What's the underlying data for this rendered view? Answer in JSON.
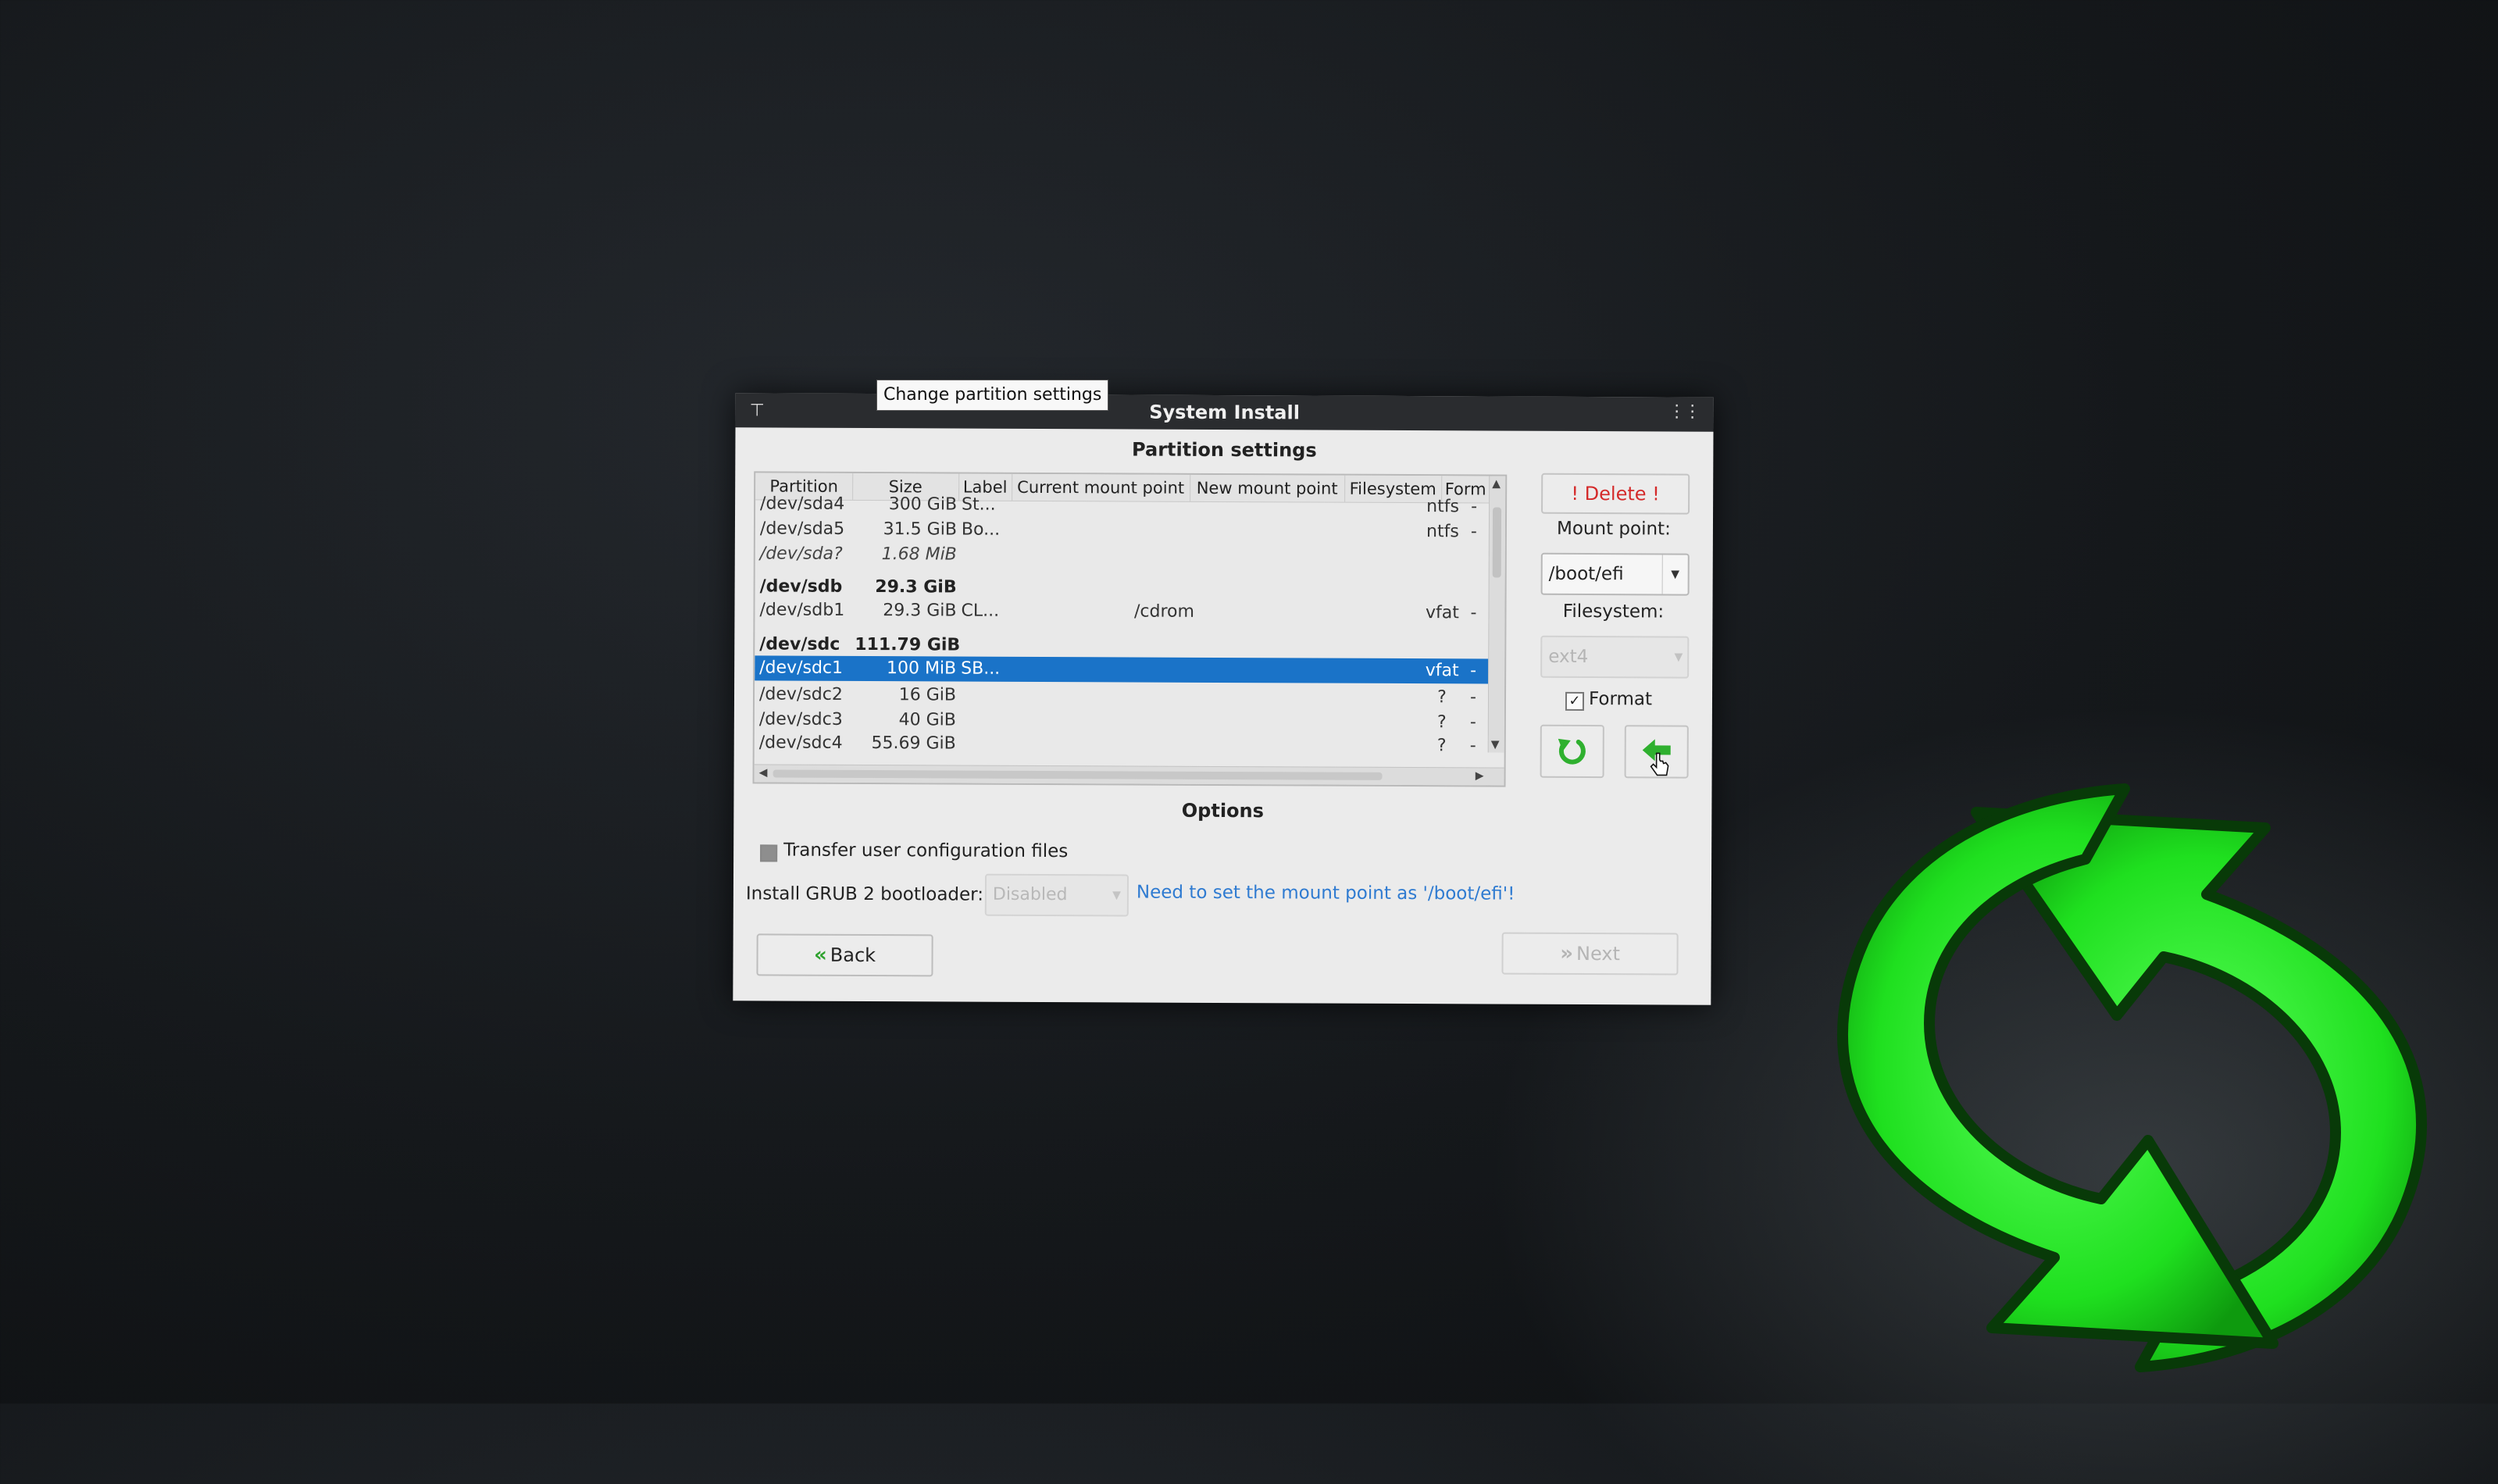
{
  "window": {
    "title": "System Install"
  },
  "partition_settings": {
    "heading": "Partition settings",
    "columns": [
      "Partition",
      "Size",
      "Label",
      "Current mount point",
      "New mount point",
      "Filesystem",
      "Form"
    ],
    "rows": [
      {
        "partition": "/dev/sda4",
        "size": "300 GiB",
        "label": "St...",
        "current_mount": "",
        "new_mount": "",
        "filesystem": "ntfs",
        "format": "-"
      },
      {
        "partition": "/dev/sda5",
        "size": "31.5 GiB",
        "label": "Bo...",
        "current_mount": "",
        "new_mount": "",
        "filesystem": "ntfs",
        "format": "-"
      },
      {
        "partition": "/dev/sda?",
        "size": "1.68 MiB",
        "label": "",
        "current_mount": "",
        "new_mount": "",
        "filesystem": "",
        "format": ""
      },
      {
        "partition": "/dev/sdb",
        "size": "29.3 GiB",
        "label": "",
        "current_mount": "",
        "new_mount": "",
        "filesystem": "",
        "format": ""
      },
      {
        "partition": "/dev/sdb1",
        "size": "29.3 GiB",
        "label": "CL...",
        "current_mount": "/cdrom",
        "new_mount": "",
        "filesystem": "vfat",
        "format": "-"
      },
      {
        "partition": "/dev/sdc",
        "size": "111.79 GiB",
        "label": "",
        "current_mount": "",
        "new_mount": "",
        "filesystem": "",
        "format": ""
      },
      {
        "partition": "/dev/sdc1",
        "size": "100 MiB",
        "label": "SB...",
        "current_mount": "",
        "new_mount": "",
        "filesystem": "vfat",
        "format": "-"
      },
      {
        "partition": "/dev/sdc2",
        "size": "16 GiB",
        "label": "",
        "current_mount": "",
        "new_mount": "",
        "filesystem": "?",
        "format": "-"
      },
      {
        "partition": "/dev/sdc3",
        "size": "40 GiB",
        "label": "",
        "current_mount": "",
        "new_mount": "",
        "filesystem": "?",
        "format": "-"
      },
      {
        "partition": "/dev/sdc4",
        "size": "55.69 GiB",
        "label": "",
        "current_mount": "",
        "new_mount": "",
        "filesystem": "?",
        "format": "-"
      }
    ],
    "delete_label": "! Delete !",
    "mount_point_label": "Mount point:",
    "mount_point_value": "/boot/efi",
    "filesystem_label": "Filesystem:",
    "filesystem_value": "ext4",
    "format_label": "Format",
    "format_checked": true,
    "tooltip": "Change partition settings"
  },
  "options": {
    "heading": "Options",
    "transfer_label": "Transfer user configuration files",
    "grub_label": "Install GRUB 2 bootloader:",
    "grub_value": "Disabled",
    "grub_hint": "Need to set the mount point as '/boot/efi'!"
  },
  "nav": {
    "back_label": "Back",
    "next_label": "Next"
  },
  "colors": {
    "selection": "#1a73c8",
    "delete_text": "#d42a2a",
    "hint_text": "#2f7bd1",
    "logo_green": "#22dd22"
  },
  "icons": [
    "pin-icon",
    "grip-icon",
    "reset-icon",
    "back-arrow-icon",
    "mouse-cursor-icon",
    "chevron-double-left-icon",
    "chevron-double-right-icon",
    "refresh-logo-icon"
  ]
}
